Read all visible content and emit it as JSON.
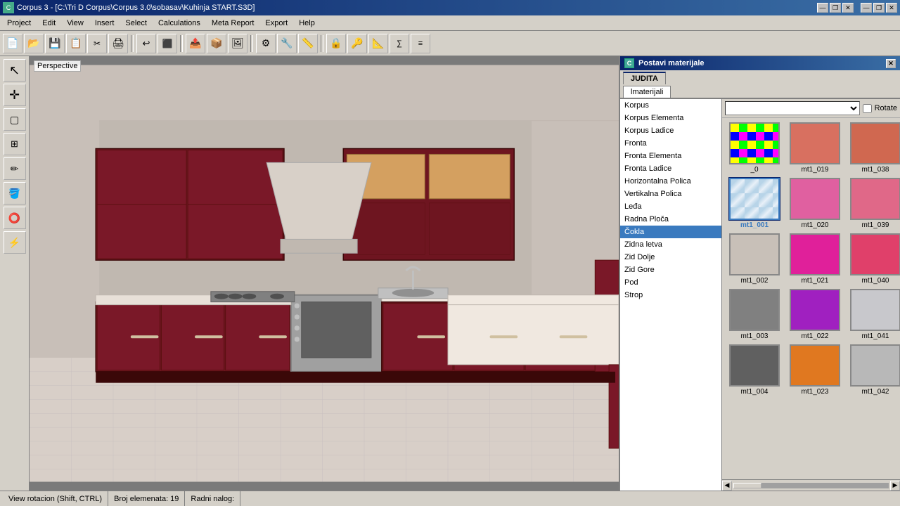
{
  "titleBar": {
    "icon": "C",
    "title": "Corpus 3 - [C:\\Tri D Corpus\\Corpus 3.0\\sobasav\\Kuhinja START.S3D]",
    "minimize": "—",
    "restore": "❐",
    "close": "✕",
    "appMin": "—",
    "appRestore": "❐",
    "appClose": "✕"
  },
  "menuBar": {
    "items": [
      "Project",
      "Edit",
      "View",
      "Insert",
      "Select",
      "Calculations",
      "Meta Report",
      "Export",
      "Help"
    ]
  },
  "toolbar": {
    "buttons": [
      "📄",
      "📂",
      "💾",
      "📋",
      "✂️",
      "🖨",
      "↩",
      "⬛",
      "📤",
      "📦",
      "🖼",
      "⚙",
      "🔧",
      "📏",
      "🔒",
      "🔑",
      "📐"
    ]
  },
  "leftSidebar": {
    "tools": [
      "↖",
      "✛",
      "🔲",
      "⊞",
      "✏",
      "🪣",
      "⭕",
      "⚡"
    ]
  },
  "viewport": {
    "label": "Perspective"
  },
  "panel": {
    "title": "Postavi materijale",
    "closeBtn": "✕",
    "tabs": [
      "JUDITA"
    ],
    "subtabs": [
      "lmaterijali"
    ],
    "dropdown": {
      "value": "",
      "placeholder": ""
    },
    "rotateLabel": "Rotate",
    "materialsListLabel": "Korpus",
    "materialsList": [
      "Korpus",
      "Korpus Elementa",
      "Korpus Ladice",
      "Fronta",
      "Fronta Elementa",
      "Fronta Ladice",
      "Horizontalna Polica",
      "Vertikalna Polica",
      "Leđa",
      "Radna Ploča",
      "Čokla",
      "Zidna letva",
      "Zid Dolje",
      "Zid Gore",
      "Pod",
      "Strop"
    ],
    "selectedMaterial": "Čokla",
    "swatches": [
      {
        "id": "_0",
        "color": "checker",
        "label": "_0",
        "selected": false
      },
      {
        "id": "mt1_019",
        "color": "#d87060",
        "label": "mt1_019",
        "selected": false
      },
      {
        "id": "mt1_038",
        "color": "#d06850",
        "label": "mt1_038",
        "selected": false
      },
      {
        "id": "mt1_001",
        "color": "#8ab4d8",
        "label": "mt1_001",
        "selected": true
      },
      {
        "id": "mt1_020",
        "color": "#e060a0",
        "label": "mt1_020",
        "selected": false
      },
      {
        "id": "mt1_039",
        "color": "#e06888",
        "label": "mt1_039",
        "selected": false
      },
      {
        "id": "mt1_002",
        "color": "#c8c0b8",
        "label": "mt1_002",
        "selected": false
      },
      {
        "id": "mt1_021",
        "color": "#e0209a",
        "label": "mt1_021",
        "selected": false
      },
      {
        "id": "mt1_040",
        "color": "#e0406a",
        "label": "mt1_040",
        "selected": false
      },
      {
        "id": "mt1_003",
        "color": "#808080",
        "label": "mt1_003",
        "selected": false
      },
      {
        "id": "mt1_022",
        "color": "#a020c0",
        "label": "mt1_022",
        "selected": false
      },
      {
        "id": "mt1_041",
        "color": "#c8c8cc",
        "label": "mt1_041",
        "selected": false
      },
      {
        "id": "mt1_004",
        "color": "#606060",
        "label": "mt1_004",
        "selected": false
      },
      {
        "id": "mt1_023",
        "color": "#e07820",
        "label": "mt1_023",
        "selected": false
      },
      {
        "id": "mt1_042",
        "color": "#b8b8b8",
        "label": "mt1_042",
        "selected": false
      }
    ]
  },
  "statusBar": {
    "viewInfo": "View rotacion (Shift, CTRL)",
    "elemCount": "Broj elemenata: 19",
    "radniNalog": "Radni nalog:"
  }
}
